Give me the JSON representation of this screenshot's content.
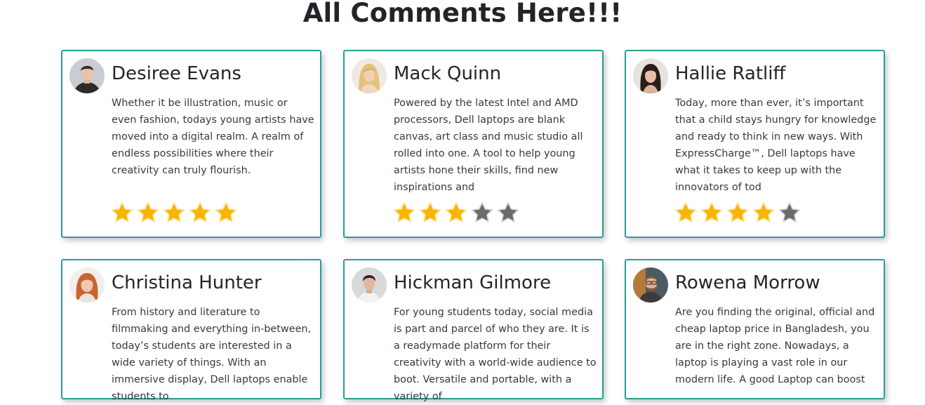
{
  "page": {
    "title": "All Comments Here!!!"
  },
  "colors": {
    "card_border": "#2a9d96",
    "star_filled": "#f7b500",
    "star_empty": "#6b6b6b"
  },
  "comments": [
    {
      "name": "Desiree Evans",
      "avatar_icon": "man-dark-shirt-avatar",
      "text": "Whether it be illustration, music or even fashion, todays young artists have moved into a digital realm. A realm of endless possibilities where their creativity can truly flourish.",
      "rating": 5,
      "max_rating": 5
    },
    {
      "name": "Mack Quinn",
      "avatar_icon": "blonde-woman-avatar",
      "text": "Powered by the latest Intel and AMD processors, Dell laptops are blank canvas, art class and music studio all rolled into one. A tool to help young artists hone their skills, find new inspirations and",
      "rating": 3,
      "max_rating": 5
    },
    {
      "name": "Hallie Ratliff",
      "avatar_icon": "dark-haired-woman-avatar",
      "text": "Today, more than ever, it’s important that a child stays hungry for knowledge and ready to think in new ways. With ExpressCharge™, Dell laptops have what it takes to keep up with the innovators of tod",
      "rating": 4,
      "max_rating": 5
    },
    {
      "name": "Christina Hunter",
      "avatar_icon": "red-haired-woman-avatar",
      "text": "From history and literature to filmmaking and everything in-between, today’s students are interested in a wide variety of things. With an immersive display, Dell laptops enable students to",
      "rating": 0,
      "max_rating": 5
    },
    {
      "name": "Hickman Gilmore",
      "avatar_icon": "man-stubble-avatar",
      "text": "For young students today, social media is part and parcel of who they are. It is a readymade platform for their creativity with a world-wide audience to boot. Versatile and portable, with a variety of",
      "rating": 0,
      "max_rating": 5
    },
    {
      "name": "Rowena Morrow",
      "avatar_icon": "bearded-man-glasses-avatar",
      "text": "Are you finding the original, official and cheap laptop price in Bangladesh, you are in the right zone. Nowadays, a laptop is playing a vast role in our modern life. A good Laptop can boost",
      "rating": 0,
      "max_rating": 5
    }
  ]
}
